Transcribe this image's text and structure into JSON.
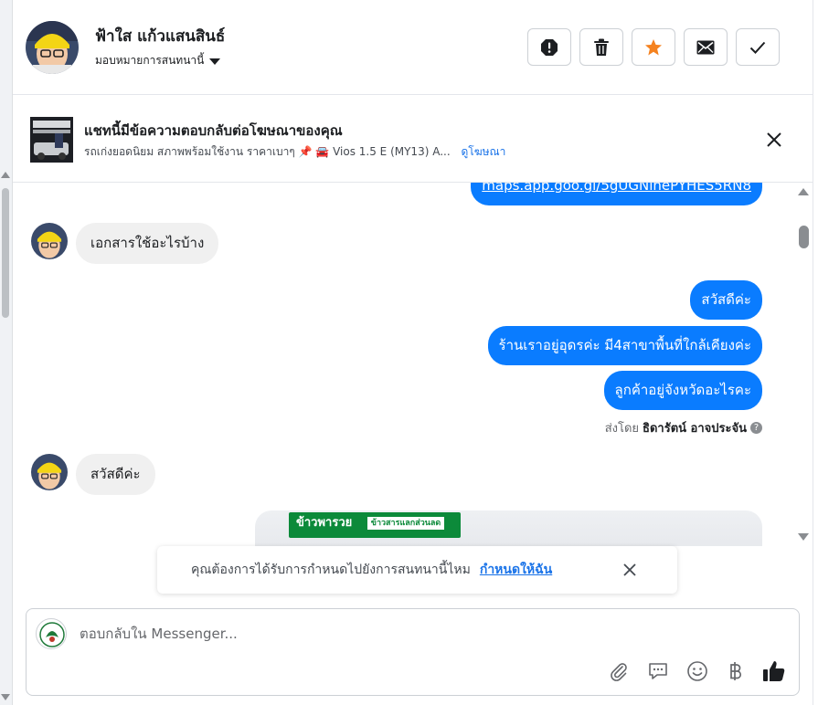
{
  "header": {
    "name": "ฟ้าใส แก้วแสนสินธ์",
    "assign_label": "มอบหมายการสนทนานี้"
  },
  "header_actions": [
    {
      "name": "spam-button",
      "icon": "exclamation-octagon-icon"
    },
    {
      "name": "delete-button",
      "icon": "trash-icon"
    },
    {
      "name": "star-button",
      "icon": "star-icon",
      "color": "#f5821f"
    },
    {
      "name": "mark-unread-button",
      "icon": "envelope-icon"
    },
    {
      "name": "mark-done-button",
      "icon": "check-icon"
    }
  ],
  "ad_banner": {
    "title": "แชทนี้มีข้อความตอบกลับต่อโฆษณาของคุณ",
    "description": "รถเก่งยอดนิยม สภาพพร้อมใช้งาน ราคาเบาๆ 📌 🚘 Vios 1.5 E (MY13) A...",
    "link": "ดูโฆษณา"
  },
  "messages": [
    {
      "type": "outgoing",
      "text": "maps.app.goo.gl/5gUGNinePYHES5RN8"
    },
    {
      "type": "incoming",
      "text": "เอกสารใช้อะไรบ้าง"
    },
    {
      "type": "outgoing",
      "text": "สวัสดีค่ะ"
    },
    {
      "type": "outgoing",
      "text": "ร้านเราอยู่อุดรค่ะ มี4สาขาพื้นที่ใกล้เคียงค่ะ"
    },
    {
      "type": "outgoing",
      "text": "ลูกค้าอยู่จังหวัดอะไรคะ"
    },
    {
      "type": "incoming",
      "text": "สวัสดีค่ะ"
    }
  ],
  "sent_by": {
    "prefix": "ส่งโดย",
    "name": "ธิดารัตน์ อาจประจัน"
  },
  "image_card": {
    "brand_text": "ข้าวพารวย",
    "badge_text": "ข้าวสารแลกส่วนลด"
  },
  "reminder_prompt": {
    "text": "คุณต้องการได้รับการกำหนดไปยังการสนทนานี้ไหม",
    "link": "กำหนดให้ฉัน"
  },
  "composer": {
    "placeholder": "ตอบกลับใน Messenger...",
    "tools": [
      "paperclip-icon",
      "saved-reply-icon",
      "emoji-icon",
      "baht-icon",
      "thumbs-up-icon"
    ]
  },
  "colors": {
    "accent": "#0a7cff",
    "link": "#1a73e8",
    "star": "#f5821f"
  }
}
